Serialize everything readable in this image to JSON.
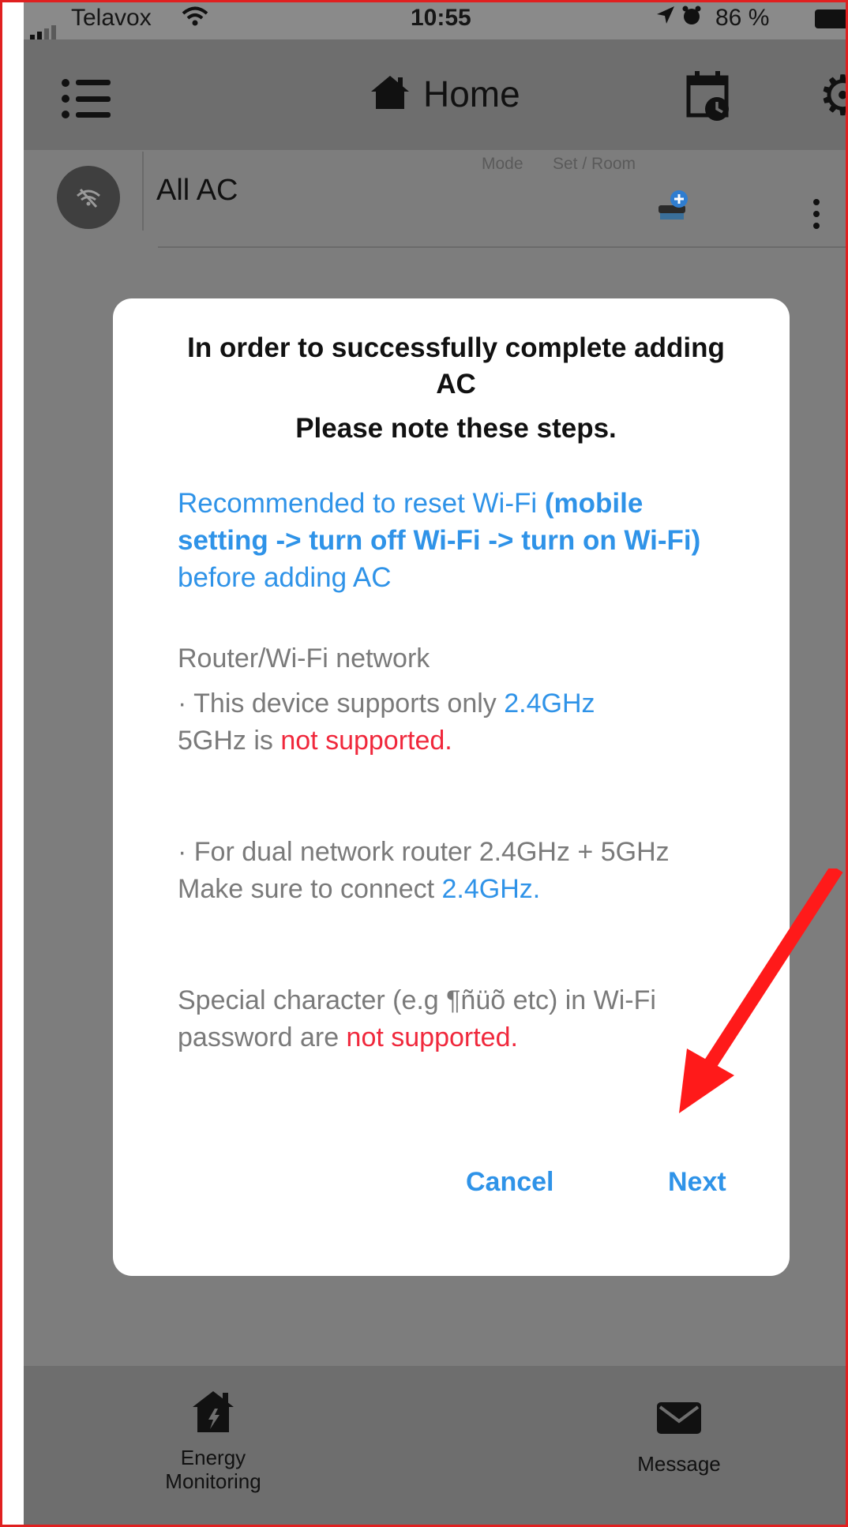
{
  "status_bar": {
    "carrier": "Telavox",
    "time": "10:55",
    "battery": "86 %"
  },
  "header": {
    "title": "Home"
  },
  "room": {
    "name": "All AC",
    "mode_label": "Mode",
    "set_room_label": "Set / Room"
  },
  "dialog": {
    "title": "In order to successfully complete adding AC",
    "subtitle": "Please note these steps.",
    "wifi_reset_part1": "Recommended to reset Wi-Fi ",
    "wifi_reset_bold": "(mobile setting -> turn off Wi-Fi -> turn on Wi-Fi)",
    "wifi_reset_part2": " before adding AC",
    "router_heading": "Router/Wi-Fi network",
    "support_prefix": "· This device supports only ",
    "support_freq": "2.4GHz",
    "support_5g_prefix": "5GHz is ",
    "not_supported": "not supported.",
    "dual_line": "· For dual network router 2.4GHz + 5GHz",
    "connect_prefix": "Make sure to connect ",
    "connect_freq": "2.4GHz.",
    "special_char_text": "Special character (e.g ¶ñüõ etc) in Wi-Fi password are ",
    "special_not_supported": "not supported.",
    "cancel_label": "Cancel",
    "next_label": "Next"
  },
  "bottom_nav": {
    "energy_label": "Energy Monitoring",
    "message_label": "Message"
  },
  "colors": {
    "link_blue": "#2f93e8",
    "warning_red": "#f0283c",
    "annotation_red": "#e02020"
  },
  "icons": [
    "signal-icon",
    "wifi-icon",
    "location-icon",
    "alarm-icon",
    "battery-icon",
    "menu-icon",
    "home-icon",
    "schedule-icon",
    "gear-icon",
    "wifi-off-icon",
    "add-ac-icon",
    "kebab-icon",
    "energy-icon",
    "message-icon"
  ]
}
